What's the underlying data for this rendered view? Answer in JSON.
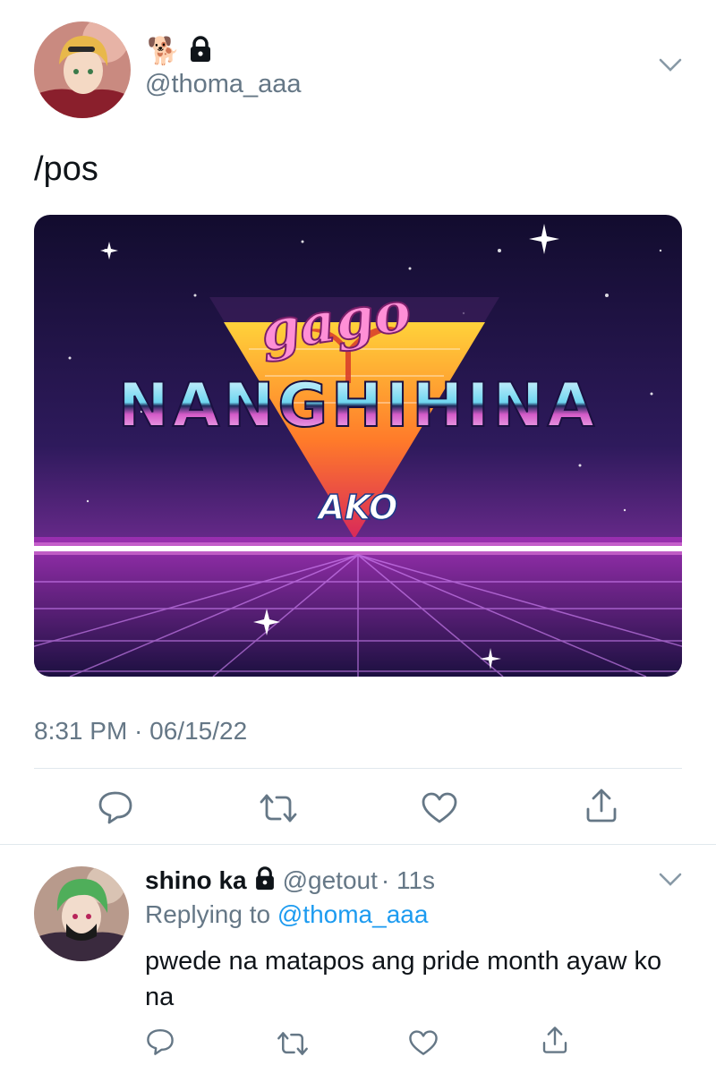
{
  "main_tweet": {
    "emojis": "🐕",
    "handle": "@thoma_aaa",
    "text": "/pos",
    "image": {
      "top_script": "gago",
      "headline": "NANGHIHINA",
      "bottom": "AKO"
    },
    "timestamp": "8:31 PM · 06/15/22"
  },
  "reply": {
    "name": "shino ka",
    "handle": "@getout",
    "time": "· 11s",
    "replying_label": "Replying to",
    "replying_handle": "@thoma_aaa",
    "text": "pwede na matapos ang pride month ayaw ko na"
  },
  "icons": [
    "chevron-down-icon",
    "lock-icon",
    "reply-icon",
    "retweet-icon",
    "like-icon",
    "share-icon"
  ]
}
